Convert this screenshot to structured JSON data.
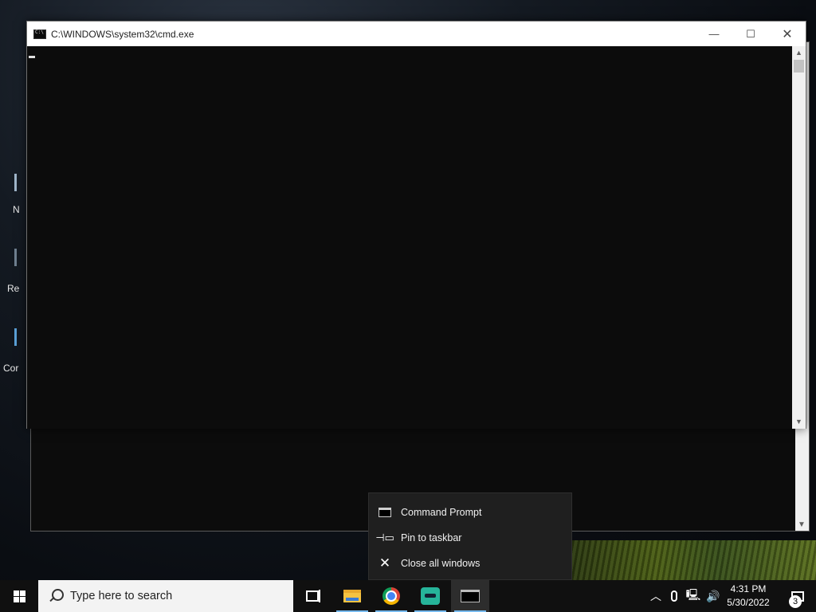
{
  "window": {
    "title": "C:\\WINDOWS\\system32\\cmd.exe",
    "minimize_glyph": "—",
    "maximize_glyph": "☐",
    "close_glyph": "✕"
  },
  "desktop": {
    "labels": [
      "N",
      "Re",
      "Cor"
    ]
  },
  "jumplist": {
    "items": [
      {
        "label": "Command Prompt",
        "icon": "cmd-icon"
      },
      {
        "label": "Pin to taskbar",
        "icon": "pin-icon"
      },
      {
        "label": "Close all windows",
        "icon": "close-icon"
      }
    ]
  },
  "taskbar": {
    "search_placeholder": "Type here to search",
    "apps": [
      "task-view",
      "file-explorer",
      "chrome",
      "green-app",
      "command-prompt"
    ],
    "active_app": "command-prompt",
    "tray_icons": [
      "chevron-up-icon",
      "microphone-icon",
      "network-icon",
      "volume-icon"
    ],
    "time": "4:31 PM",
    "date": "5/30/2022",
    "notification_count": "3"
  }
}
